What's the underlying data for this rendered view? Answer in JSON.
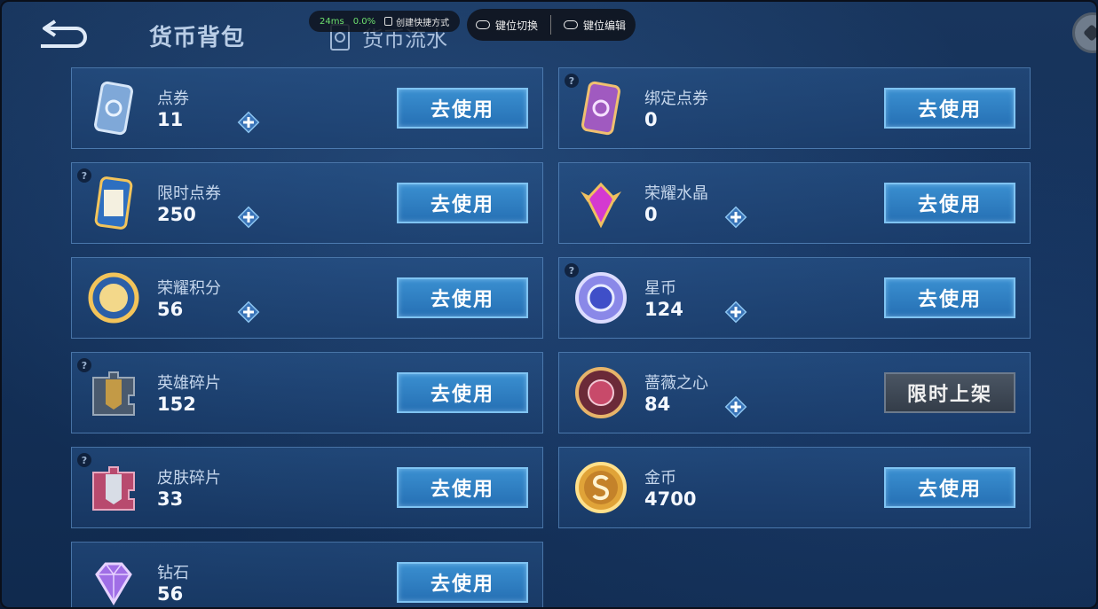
{
  "header": {
    "tab_backpack": "货币背包",
    "tab_flow": "货币流水"
  },
  "overlay": {
    "latency": "24ms",
    "loss": "0.0%",
    "shortcut": "创建快捷方式",
    "key_switch": "键位切换",
    "key_edit": "键位编辑"
  },
  "currencies": [
    {
      "name": "点券",
      "amount": "11",
      "action": "去使用",
      "has_plus": true,
      "has_help": false,
      "icon": "ticket-blue-icon"
    },
    {
      "name": "绑定点券",
      "amount": "0",
      "action": "去使用",
      "has_plus": false,
      "has_help": true,
      "icon": "ticket-purple-icon"
    },
    {
      "name": "限时点券",
      "amount": "250",
      "action": "去使用",
      "has_plus": true,
      "has_help": true,
      "icon": "limited-ticket-icon"
    },
    {
      "name": "荣耀水晶",
      "amount": "0",
      "action": "去使用",
      "has_plus": true,
      "has_help": false,
      "icon": "glory-crystal-icon"
    },
    {
      "name": "荣耀积分",
      "amount": "56",
      "action": "去使用",
      "has_plus": true,
      "has_help": false,
      "icon": "glory-points-icon"
    },
    {
      "name": "星币",
      "amount": "124",
      "action": "去使用",
      "has_plus": true,
      "has_help": true,
      "icon": "star-coin-icon"
    },
    {
      "name": "英雄碎片",
      "amount": "152",
      "action": "去使用",
      "has_plus": false,
      "has_help": true,
      "icon": "hero-fragment-icon"
    },
    {
      "name": "蔷薇之心",
      "amount": "84",
      "action": "限时上架",
      "has_plus": true,
      "has_help": false,
      "icon": "rose-heart-icon"
    },
    {
      "name": "皮肤碎片",
      "amount": "33",
      "action": "去使用",
      "has_plus": false,
      "has_help": true,
      "icon": "skin-fragment-icon"
    },
    {
      "name": "金币",
      "amount": "4700",
      "action": "去使用",
      "has_plus": false,
      "has_help": false,
      "icon": "gold-coin-icon"
    },
    {
      "name": "钻石",
      "amount": "56",
      "action": "去使用",
      "has_plus": false,
      "has_help": false,
      "icon": "diamond-icon"
    }
  ]
}
